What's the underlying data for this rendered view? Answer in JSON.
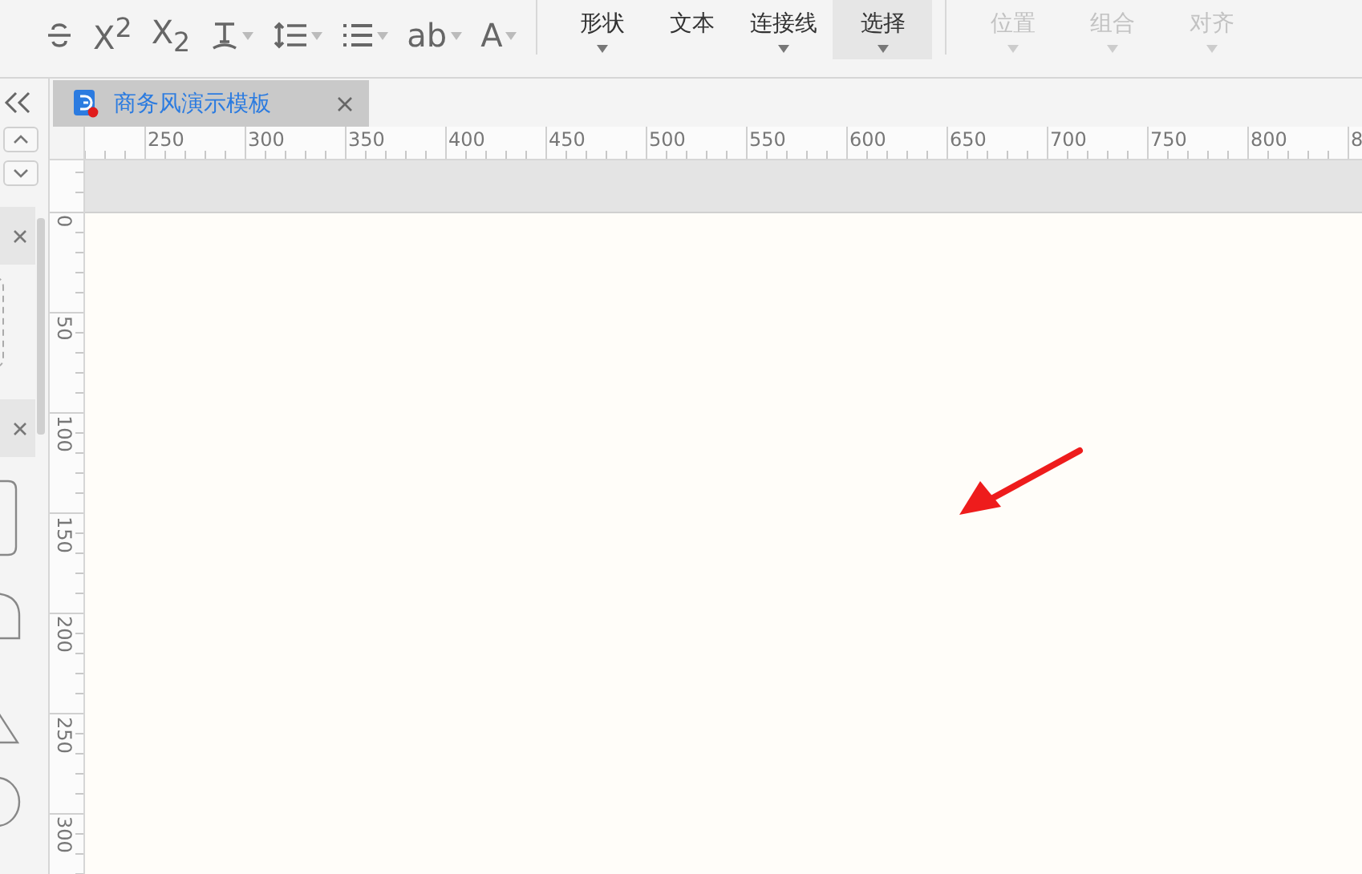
{
  "toolbar": {
    "format_tools": [
      {
        "has_menu": false
      },
      {
        "label": "X$^{2}$",
        "has_menu": false
      },
      {
        "label": "X$_{2}$",
        "has_menu": false
      },
      {
        "has_menu": true
      },
      {
        "has_menu": true
      },
      {
        "has_menu": true
      },
      {
        "label": "ab",
        "has_menu": true
      },
      {
        "label": "A",
        "has_menu": true
      }
    ],
    "menus": [
      {
        "label": "形状",
        "has_menu": true,
        "selected": false,
        "disabled": false
      },
      {
        "label": "文本",
        "has_menu": false,
        "selected": false,
        "disabled": false
      },
      {
        "label": "连接线",
        "has_menu": true,
        "selected": false,
        "disabled": false
      },
      {
        "label": "选择",
        "has_menu": true,
        "selected": true,
        "disabled": false
      }
    ],
    "arrange_menus": [
      {
        "label": "位置",
        "has_menu": true,
        "disabled": true
      },
      {
        "label": "组合",
        "has_menu": true,
        "disabled": true
      },
      {
        "label": "对齐",
        "has_menu": true,
        "disabled": true
      }
    ]
  },
  "tabs": [
    {
      "title": "商务风演示模板",
      "selected": true,
      "modified": true
    }
  ],
  "horizontal_ruler": [
    "250",
    "300",
    "350",
    "400",
    "450",
    "500",
    "550",
    "600",
    "650",
    "700",
    "750",
    "800",
    "8"
  ],
  "vertical_ruler": [
    "0",
    "50",
    "100",
    "150",
    "200",
    "250",
    "300"
  ]
}
